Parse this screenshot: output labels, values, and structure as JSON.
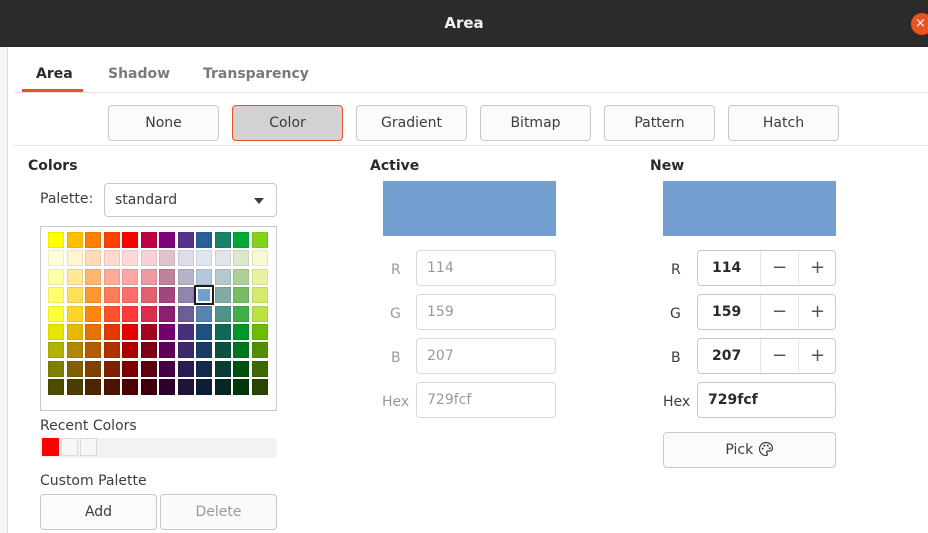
{
  "window": {
    "title": "Area",
    "close_glyph": "×"
  },
  "tabs": [
    {
      "label": "Area"
    },
    {
      "label": "Shadow"
    },
    {
      "label": "Transparency"
    }
  ],
  "fill_types": [
    "None",
    "Color",
    "Gradient",
    "Bitmap",
    "Pattern",
    "Hatch"
  ],
  "selected_fill": "Color",
  "colors": {
    "title": "Colors",
    "palette_label": "Palette:",
    "palette_value": "standard",
    "swatch_rows": [
      [
        "#ffff00",
        "#ffbf00",
        "#ff8000",
        "#ff4000",
        "#ff0000",
        "#bf0041",
        "#800080",
        "#55308d",
        "#2a6099",
        "#158466",
        "#00a933",
        "#81d41a"
      ],
      [
        "#ffffd7",
        "#fff5ce",
        "#ffdbb6",
        "#ffd8ce",
        "#ffd7d7",
        "#f7d1d5",
        "#e0c2cd",
        "#dedce6",
        "#dee6ef",
        "#dee7e5",
        "#dde8cb",
        "#f6f9d4"
      ],
      [
        "#ffffa6",
        "#ffe994",
        "#ffb66c",
        "#ffaa95",
        "#ffa6a6",
        "#ec9ba4",
        "#bf819e",
        "#b7b3ca",
        "#b4c7dc",
        "#b3cac7",
        "#afd095",
        "#e8f2a1"
      ],
      [
        "#ffff6d",
        "#ffde59",
        "#ff972f",
        "#ff7b59",
        "#ff6d6d",
        "#e16173",
        "#a1467e",
        "#8e86ae",
        "#729fcf",
        "#81aca6",
        "#77bc65",
        "#d4ea6b"
      ],
      [
        "#ffff38",
        "#ffd428",
        "#ff860d",
        "#ff5429",
        "#ff3838",
        "#d62e4e",
        "#8d1d75",
        "#6b5e9b",
        "#5983b0",
        "#50938a",
        "#3faf46",
        "#bbe33d"
      ],
      [
        "#e6e600",
        "#e6b800",
        "#e67300",
        "#e63900",
        "#e60000",
        "#a50021",
        "#730073",
        "#483080",
        "#1e5080",
        "#0f6b54",
        "#009628",
        "#6bbd00"
      ],
      [
        "#b2b200",
        "#b28600",
        "#b25d00",
        "#b23100",
        "#b20000",
        "#7a0017",
        "#5c005c",
        "#3c286b",
        "#1a3c66",
        "#0c5242",
        "#00751e",
        "#548e00"
      ],
      [
        "#808000",
        "#806000",
        "#804000",
        "#802000",
        "#800000",
        "#5e0011",
        "#460046",
        "#2b1d52",
        "#122c4d",
        "#083d31",
        "#005214",
        "#3d6a00"
      ],
      [
        "#4d4d00",
        "#4d3d00",
        "#4d2600",
        "#4d1400",
        "#4d0000",
        "#3d000b",
        "#2e002e",
        "#1d1438",
        "#0c1e33",
        "#052921",
        "#00380d",
        "#294500"
      ]
    ],
    "selected_swatch": "#729fcf",
    "recent_label": "Recent Colors",
    "recent_colors": [
      "#ff0000",
      "#f7f7f7",
      "#f7f7f7"
    ],
    "custom_label": "Custom Palette",
    "add_label": "Add",
    "delete_label": "Delete"
  },
  "active": {
    "title": "Active",
    "color": "#729fcf",
    "r_label": "R",
    "r": "114",
    "g_label": "G",
    "g": "159",
    "b_label": "B",
    "b": "207",
    "hex_label": "Hex",
    "hex": "729fcf"
  },
  "new": {
    "title": "New",
    "color": "#729fcf",
    "r_label": "R",
    "r": "114",
    "g_label": "G",
    "g": "159",
    "b_label": "B",
    "b": "207",
    "hex_label": "Hex",
    "hex": "729fcf",
    "minus": "−",
    "plus": "+",
    "pick_label": "Pick"
  }
}
